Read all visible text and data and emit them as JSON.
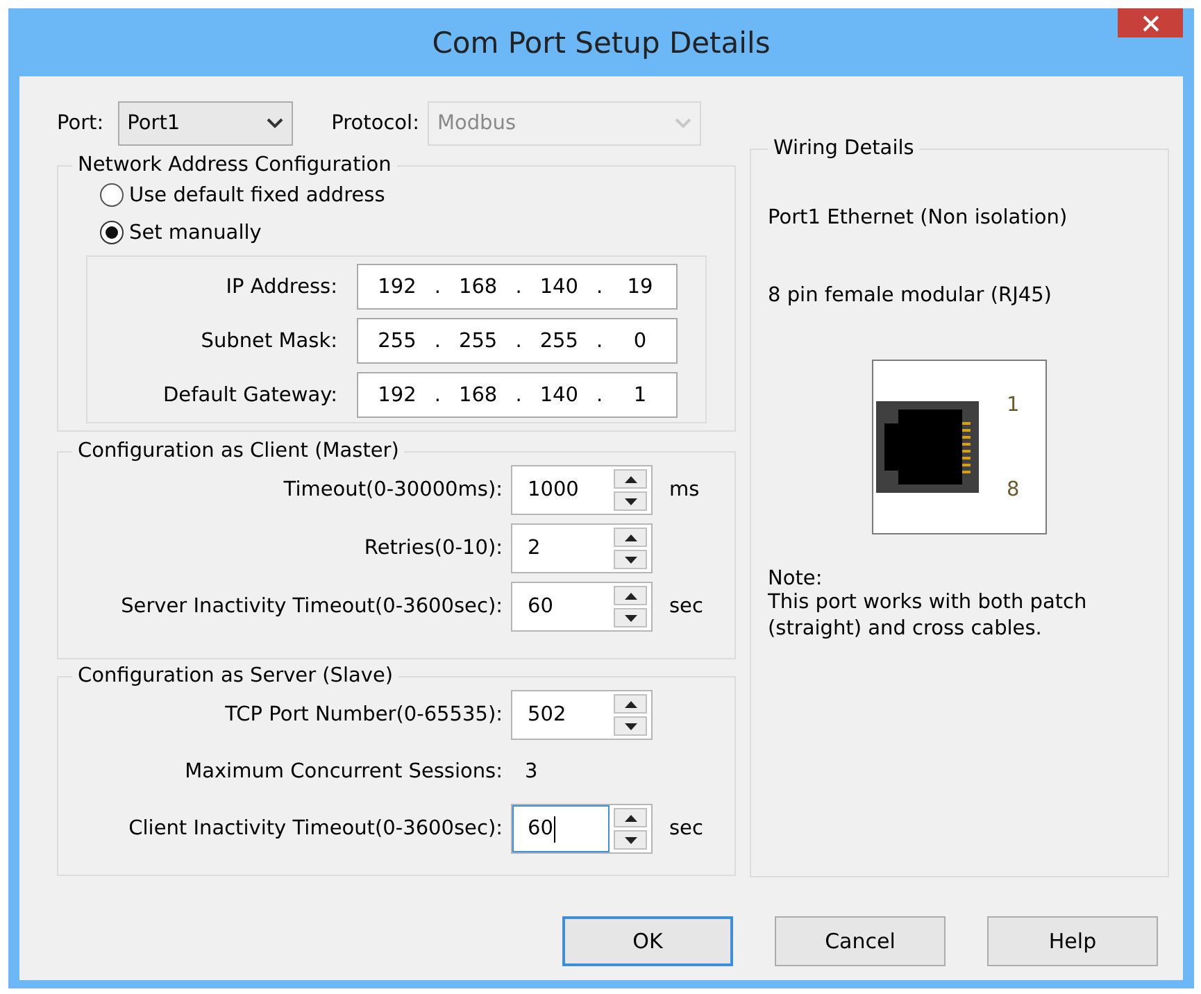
{
  "window": {
    "title": "Com Port Setup Details"
  },
  "port": {
    "label": "Port:",
    "value": "Port1"
  },
  "protocol": {
    "label": "Protocol:",
    "value": "Modbus",
    "disabled": true
  },
  "network": {
    "title": "Network Address Configuration",
    "options": [
      {
        "label": "Use default fixed address",
        "selected": false
      },
      {
        "label": "Set manually",
        "selected": true
      }
    ],
    "fields": [
      {
        "label": "IP Address:",
        "separator": ".",
        "octets": [
          "192",
          "168",
          "140",
          "19"
        ]
      },
      {
        "label": "Subnet Mask:",
        "separator": ".",
        "octets": [
          "255",
          "255",
          "255",
          "0"
        ]
      },
      {
        "label": "Default Gateway:",
        "separator": ".",
        "octets": [
          "192",
          "168",
          "140",
          "1"
        ]
      }
    ]
  },
  "client": {
    "title": "Configuration as Client (Master)",
    "rows": [
      {
        "kind": "spinner",
        "label": "Timeout(0-30000ms):",
        "value": "1000",
        "unit": "ms",
        "focused": false
      },
      {
        "kind": "spinner",
        "label": "Retries(0-10):",
        "value": "2",
        "focused": false
      },
      {
        "kind": "spinner",
        "label": "Server Inactivity Timeout(0-3600sec):",
        "value": "60",
        "unit": "sec",
        "focused": false
      }
    ]
  },
  "server": {
    "title": "Configuration as Server (Slave)",
    "rows": [
      {
        "kind": "spinner",
        "label": "TCP Port Number(0-65535):",
        "value": "502",
        "focused": false
      },
      {
        "kind": "readout",
        "label": "Maximum Concurrent Sessions:",
        "value": "3"
      },
      {
        "kind": "spinner",
        "label": "Client Inactivity Timeout(0-3600sec):",
        "value": "60",
        "unit": "sec",
        "focused": true
      }
    ]
  },
  "wiring": {
    "title": "Wiring Details",
    "lines": [
      "Port1 Ethernet (Non isolation)",
      "8 pin female modular (RJ45)"
    ],
    "pin_first": "1",
    "pin_last": "8",
    "note_title": "Note:",
    "note": "This port works with both patch (straight) and cross cables."
  },
  "buttons": [
    {
      "label": "OK",
      "default": true
    },
    {
      "label": "Cancel",
      "default": false
    },
    {
      "label": "Help",
      "default": false
    }
  ]
}
